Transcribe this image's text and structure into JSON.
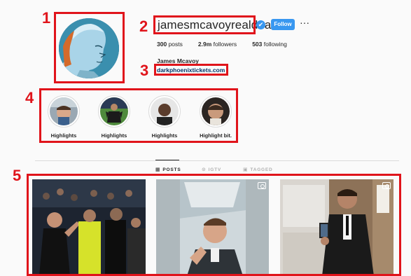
{
  "profile": {
    "username": "jamesmcavoyrealdeal",
    "verified_badge": "✔",
    "follow_label": "Follow",
    "more_label": "···",
    "stats": {
      "posts_count": "300",
      "posts_label": "posts",
      "followers_count": "2.9m",
      "followers_label": "followers",
      "following_count": "503",
      "following_label": "following"
    },
    "full_name": "James Mcavoy",
    "website": "darkphoenixtickets.com"
  },
  "highlights": [
    {
      "label": "Highlights",
      "icon": "photo-highlight-selfie"
    },
    {
      "label": "Highlights",
      "icon": "photo-highlight-stadium"
    },
    {
      "label": "Highlights",
      "icon": "photo-highlight-portrait"
    },
    {
      "label": "Highlight bit.",
      "icon": "photo-highlight-closeup"
    }
  ],
  "tabs": [
    {
      "label": "POSTS",
      "icon": "grid-icon",
      "glyph": "▦",
      "active": true
    },
    {
      "label": "IGTV",
      "icon": "tv-icon",
      "glyph": "⊙",
      "active": false
    },
    {
      "label": "TAGGED",
      "icon": "tag-icon",
      "glyph": "▣",
      "active": false
    }
  ],
  "annotations": [
    "1",
    "2",
    "3",
    "4",
    "5"
  ],
  "colors": {
    "annotation_red": "#e0141b",
    "follow_blue": "#3897f0",
    "link_blue": "#003569"
  }
}
